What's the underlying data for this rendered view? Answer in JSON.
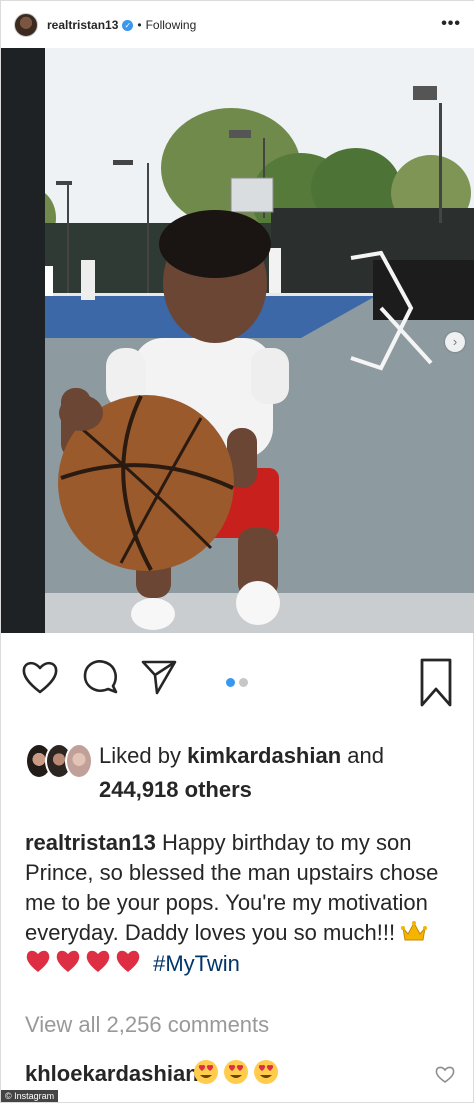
{
  "header": {
    "username": "realtristan13",
    "verified_glyph": "✓",
    "separator": "•",
    "follow_status": "Following",
    "more_label": "•••"
  },
  "photo": {
    "description_icon": "photo-of-toddler-with-basketball",
    "next_glyph": "›"
  },
  "carousel": {
    "count": 2,
    "active_index": 0
  },
  "likes": {
    "prefix": "Liked by",
    "liker": "kimkardashian",
    "connector": "and",
    "others": "244,918 others"
  },
  "caption": {
    "username": "realtristan13",
    "text": "Happy birthday to my son Prince, so blessed the man upstairs chose me to be your pops. You're my motivation everyday.  Daddy loves you so much!!!",
    "hashtag": "#MyTwin"
  },
  "comments": {
    "view_all": "View all 2,256 comments",
    "top_comment_user": "khloekardashian"
  },
  "credit": "© Instagram",
  "colors": {
    "accent_blue": "#3897f0",
    "text": "#262626",
    "muted": "#999999",
    "hashtag": "#003569",
    "heart_red": "#e0245e"
  }
}
